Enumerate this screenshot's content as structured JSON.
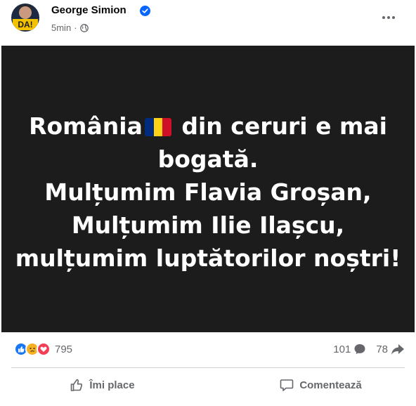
{
  "post": {
    "author": "George Simion",
    "time": "5min",
    "privacy_icon": "globe-icon",
    "verified_icon": "verified-badge-icon",
    "avatar_label": "DA!",
    "more_icon": "more-options-icon"
  },
  "image_text": {
    "line1_part1": "România",
    "line1_part2": "din ceruri e mai",
    "line2": "bogată.",
    "line3": "Mulțumim Flavia Groșan,",
    "line4": "Mulțumim Ilie Ilașcu,",
    "line5": "mulțumim luptătorilor noștri!",
    "flag_colors": [
      "#002b7f",
      "#fcd116",
      "#ce1126"
    ]
  },
  "stats": {
    "reaction_icons": [
      "like-icon",
      "sad-icon",
      "love-icon"
    ],
    "reaction_count": "795",
    "comment_count": "101",
    "share_count": "78"
  },
  "actions": {
    "like_label": "Îmi place",
    "comment_label": "Comentează"
  },
  "colors": {
    "like_blue": "#1877f2",
    "love_red": "#f33e58",
    "sad_yellow": "#f7b125",
    "verified_blue": "#0866ff",
    "muted": "#65676b"
  }
}
